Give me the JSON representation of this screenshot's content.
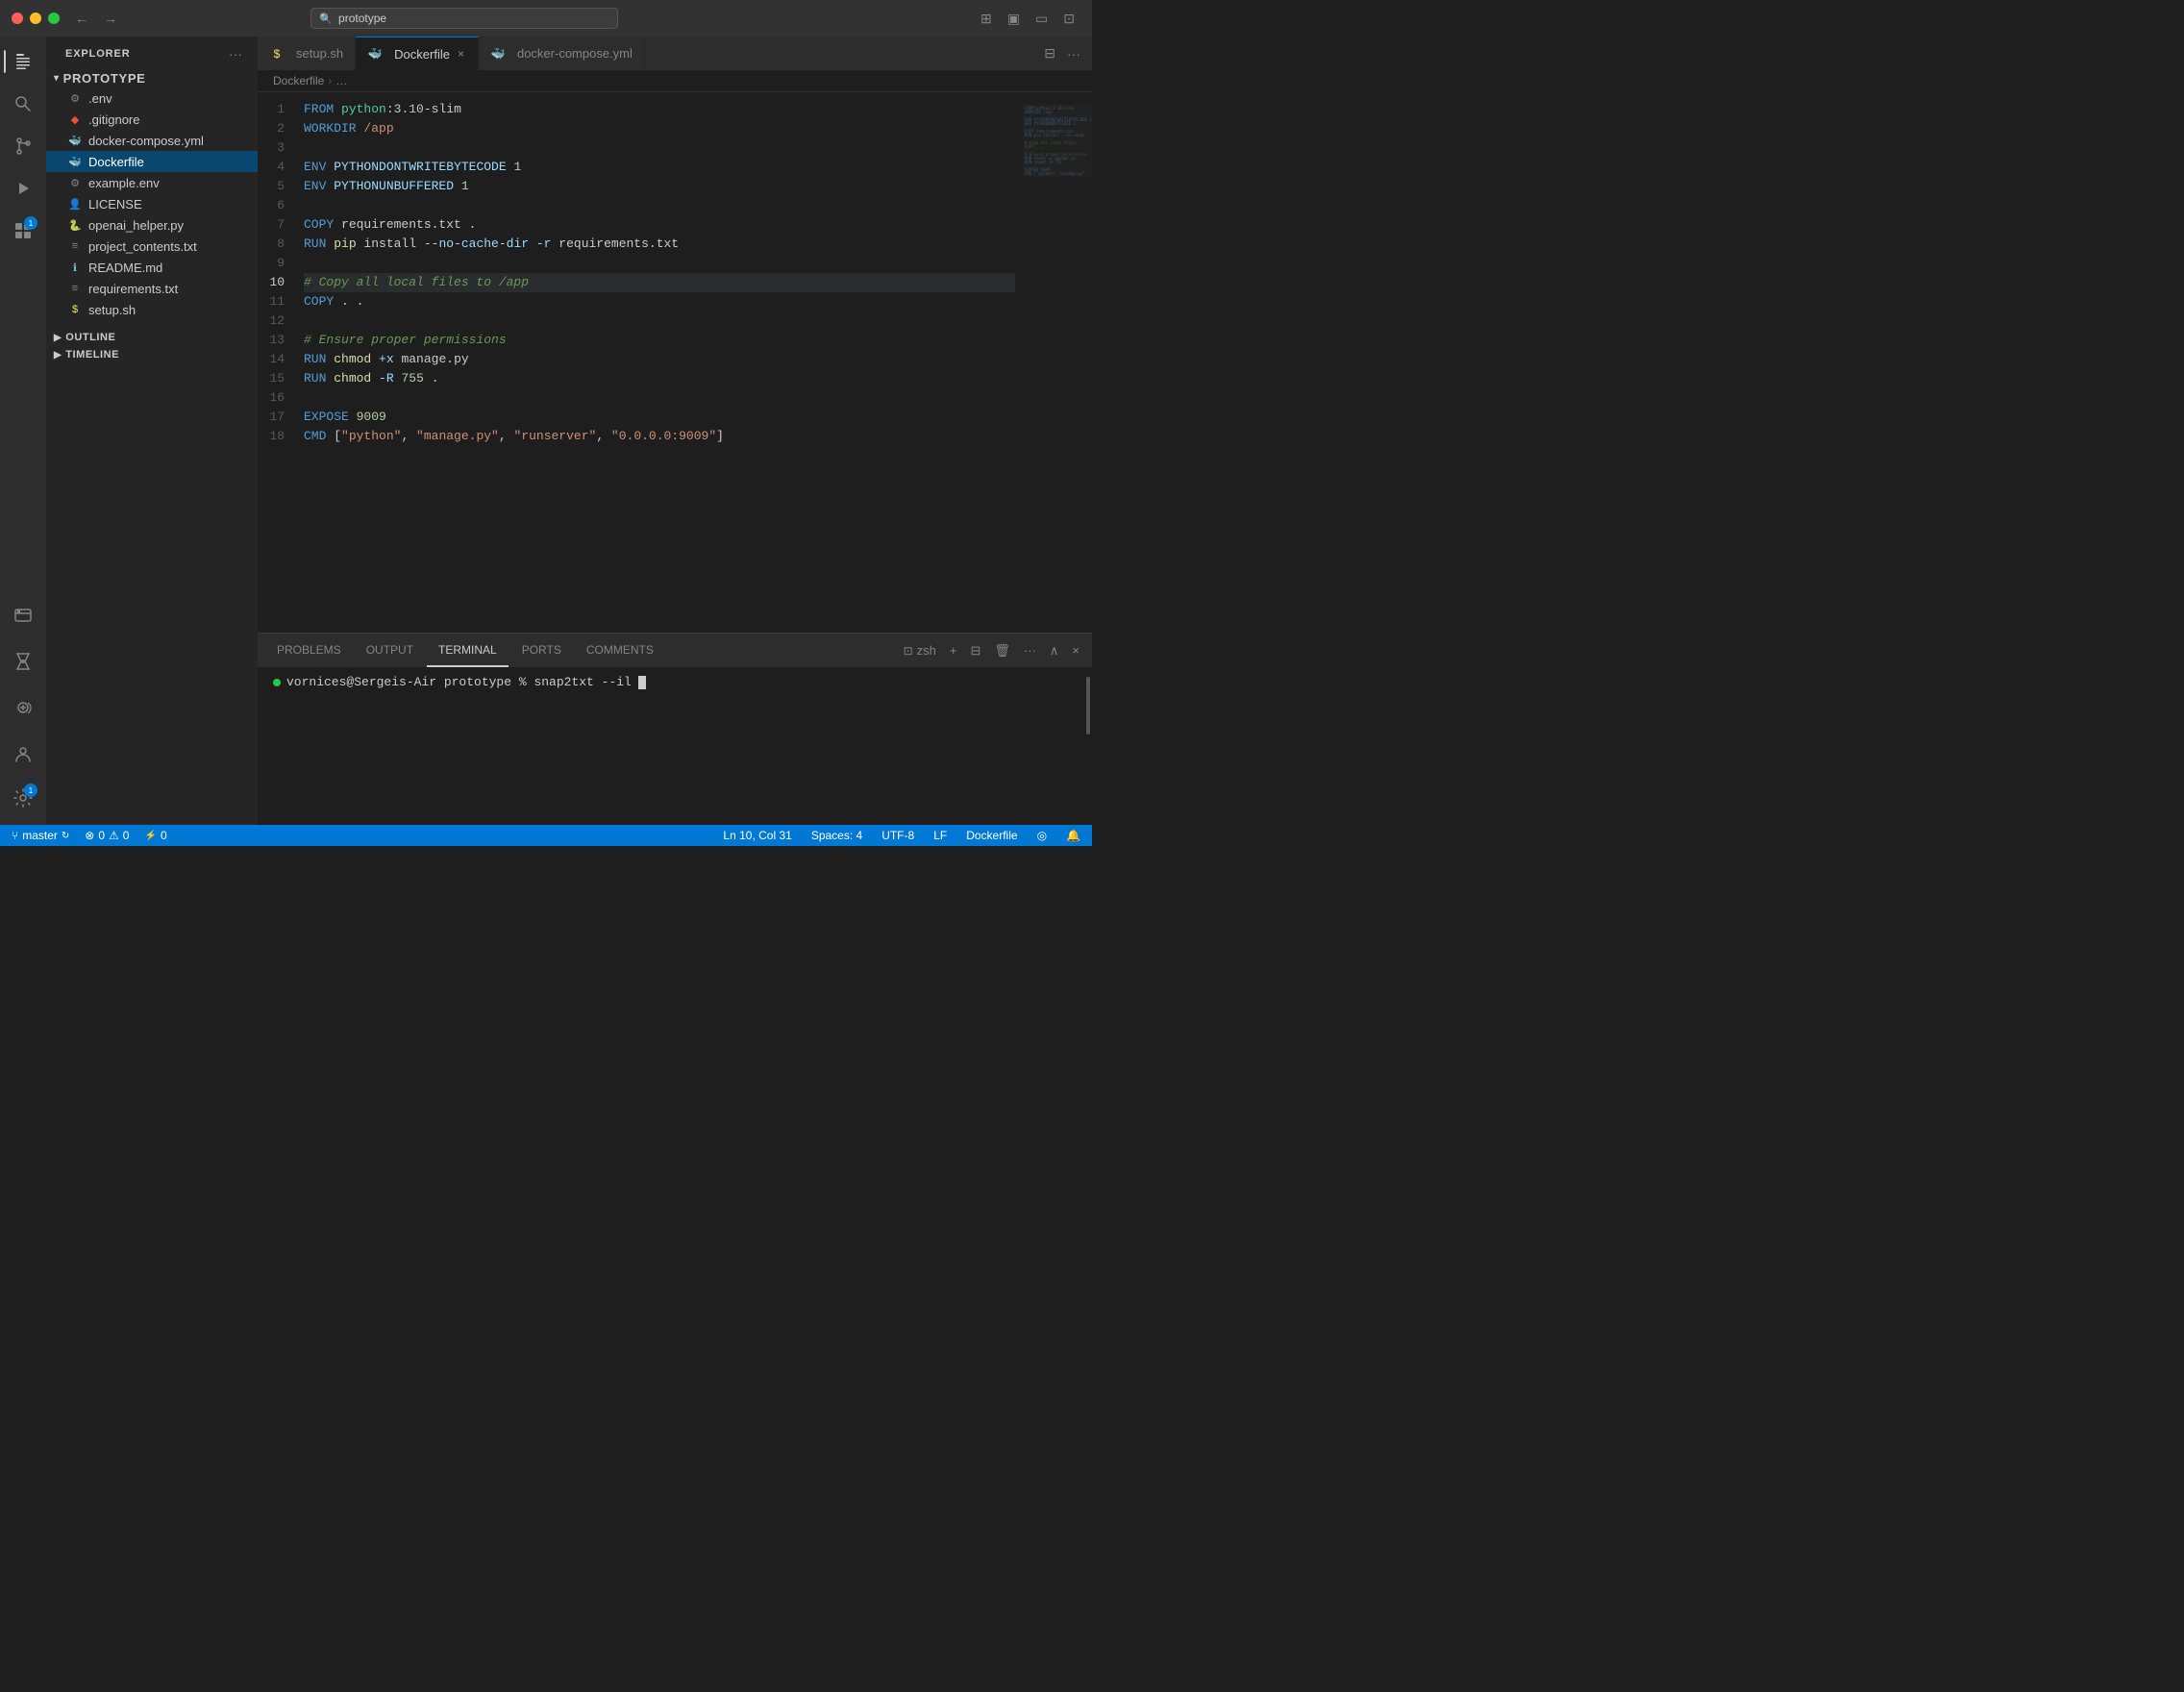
{
  "titleBar": {
    "searchPlaceholder": "prototype",
    "backBtn": "←",
    "forwardBtn": "→"
  },
  "activityBar": {
    "items": [
      {
        "id": "explorer",
        "icon": "⬜",
        "label": "Explorer",
        "active": true
      },
      {
        "id": "search",
        "icon": "🔍",
        "label": "Search"
      },
      {
        "id": "source-control",
        "icon": "⑂",
        "label": "Source Control"
      },
      {
        "id": "run",
        "icon": "▷",
        "label": "Run"
      },
      {
        "id": "extensions",
        "icon": "⊞",
        "label": "Extensions",
        "badge": "1"
      },
      {
        "id": "remote",
        "icon": "🖥",
        "label": "Remote Explorer"
      },
      {
        "id": "flask",
        "icon": "⚗",
        "label": "Testing"
      },
      {
        "id": "structure",
        "icon": "⊟",
        "label": "Structure"
      }
    ],
    "bottomItems": [
      {
        "id": "docker",
        "icon": "🐳",
        "label": "Docker"
      },
      {
        "id": "account",
        "icon": "○",
        "label": "Account"
      },
      {
        "id": "settings",
        "icon": "⚙",
        "label": "Settings",
        "badge": "1"
      }
    ]
  },
  "sidebar": {
    "title": "EXPLORER",
    "moreBtn": "···",
    "folder": {
      "name": "PROTOTYPE",
      "collapsed": false,
      "items": [
        {
          "name": ".env",
          "icon": "gear",
          "iconColor": "#858585"
        },
        {
          "name": ".gitignore",
          "icon": "diamond",
          "iconColor": "#858585"
        },
        {
          "name": "docker-compose.yml",
          "icon": "docker",
          "iconColor": "#e535ab"
        },
        {
          "name": "Dockerfile",
          "icon": "docker",
          "iconColor": "#2496ed",
          "active": true
        },
        {
          "name": "example.env",
          "icon": "gear",
          "iconColor": "#858585"
        },
        {
          "name": "LICENSE",
          "icon": "person",
          "iconColor": "#cccccc"
        },
        {
          "name": "openai_helper.py",
          "icon": "python",
          "iconColor": "#3572A5"
        },
        {
          "name": "project_contents.txt",
          "icon": "text",
          "iconColor": "#858585"
        },
        {
          "name": "README.md",
          "icon": "info",
          "iconColor": "#75bcd4"
        },
        {
          "name": "requirements.txt",
          "icon": "text",
          "iconColor": "#858585"
        },
        {
          "name": "setup.sh",
          "icon": "dollar",
          "iconColor": "#f1e05a"
        }
      ]
    },
    "outline": "OUTLINE",
    "timeline": "TIMELINE"
  },
  "tabs": [
    {
      "id": "setup-sh",
      "label": "setup.sh",
      "icon": "dollar",
      "iconColor": "#f1e05a",
      "active": false,
      "closeable": false
    },
    {
      "id": "dockerfile",
      "label": "Dockerfile",
      "icon": "docker",
      "iconColor": "#2496ed",
      "active": true,
      "closeable": true
    },
    {
      "id": "docker-compose",
      "label": "docker-compose.yml",
      "icon": "docker",
      "iconColor": "#e535ab",
      "active": false,
      "closeable": false
    }
  ],
  "breadcrumb": {
    "file": "Dockerfile",
    "separator": "›",
    "more": "…"
  },
  "code": {
    "lines": [
      {
        "num": 1,
        "content": "FROM python:3.10-slim"
      },
      {
        "num": 2,
        "content": "WORKDIR /app"
      },
      {
        "num": 3,
        "content": ""
      },
      {
        "num": 4,
        "content": "ENV PYTHONDONTWRITEBYTECODE 1"
      },
      {
        "num": 5,
        "content": "ENV PYTHONUNBUFFERED 1"
      },
      {
        "num": 6,
        "content": ""
      },
      {
        "num": 7,
        "content": "COPY requirements.txt ."
      },
      {
        "num": 8,
        "content": "RUN pip install --no-cache-dir -r requirements.txt"
      },
      {
        "num": 9,
        "content": ""
      },
      {
        "num": 10,
        "content": "# Copy all local files to /app",
        "highlight": true
      },
      {
        "num": 11,
        "content": "COPY . ."
      },
      {
        "num": 12,
        "content": ""
      },
      {
        "num": 13,
        "content": "# Ensure proper permissions"
      },
      {
        "num": 14,
        "content": "RUN chmod +x manage.py"
      },
      {
        "num": 15,
        "content": "RUN chmod -R 755 ."
      },
      {
        "num": 16,
        "content": ""
      },
      {
        "num": 17,
        "content": "EXPOSE 9009"
      },
      {
        "num": 18,
        "content": "CMD [\"python\", \"manage.py\", \"runserver\", \"0.0.0.0:9009\"]"
      }
    ]
  },
  "panel": {
    "tabs": [
      {
        "id": "problems",
        "label": "PROBLEMS"
      },
      {
        "id": "output",
        "label": "OUTPUT"
      },
      {
        "id": "terminal",
        "label": "TERMINAL",
        "active": true
      },
      {
        "id": "ports",
        "label": "PORTS"
      },
      {
        "id": "comments",
        "label": "COMMENTS"
      }
    ],
    "terminalName": "zsh",
    "terminalPrompt": "vornices@Sergeis-Air prototype % snap2txt --il",
    "cursor": true
  },
  "statusBar": {
    "branch": "master",
    "errors": "0",
    "warnings": "0",
    "noConnection": "0",
    "position": "Ln 10, Col 31",
    "spaces": "Spaces: 4",
    "encoding": "UTF-8",
    "lineEnding": "LF",
    "language": "Dockerfile",
    "sync": true,
    "bell": true
  }
}
